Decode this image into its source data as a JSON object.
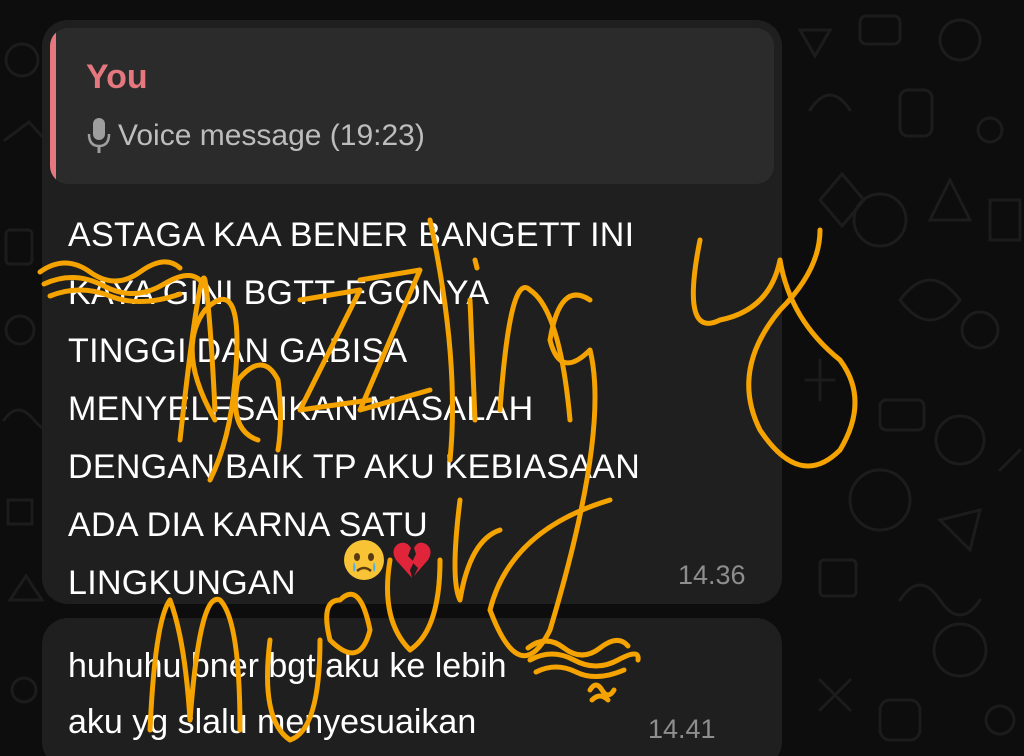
{
  "chat": {
    "reply": {
      "author": "You",
      "preview": "Voice message (19:23)",
      "icon": "microphone-icon",
      "accent_color": "#e5777e"
    },
    "messages": [
      {
        "text": "ASTAGA KAA BENER BANGETT INI\nKAYA GINI BGTT EGONYA\nTINGGI DAN GABISA\nMENYELESAIKAN MASALAH\nDENGAN BAIK TP AKU KEBIASAAN\nADA DIA KARNA SATU\nLINGKUNGAN",
        "emojis": [
          "crying-face-emoji",
          "broken-heart-emoji"
        ],
        "time": "14.36"
      },
      {
        "text": "huhuhu bner bgt aku ke lebih\naku yg slalu menyesuaikan",
        "time": "14.41"
      }
    ]
  },
  "annotation": {
    "handwriting_lines": [
      "dazzling",
      "mur"
    ],
    "color": "#f5a300",
    "redaction_color": "#f5a300"
  }
}
